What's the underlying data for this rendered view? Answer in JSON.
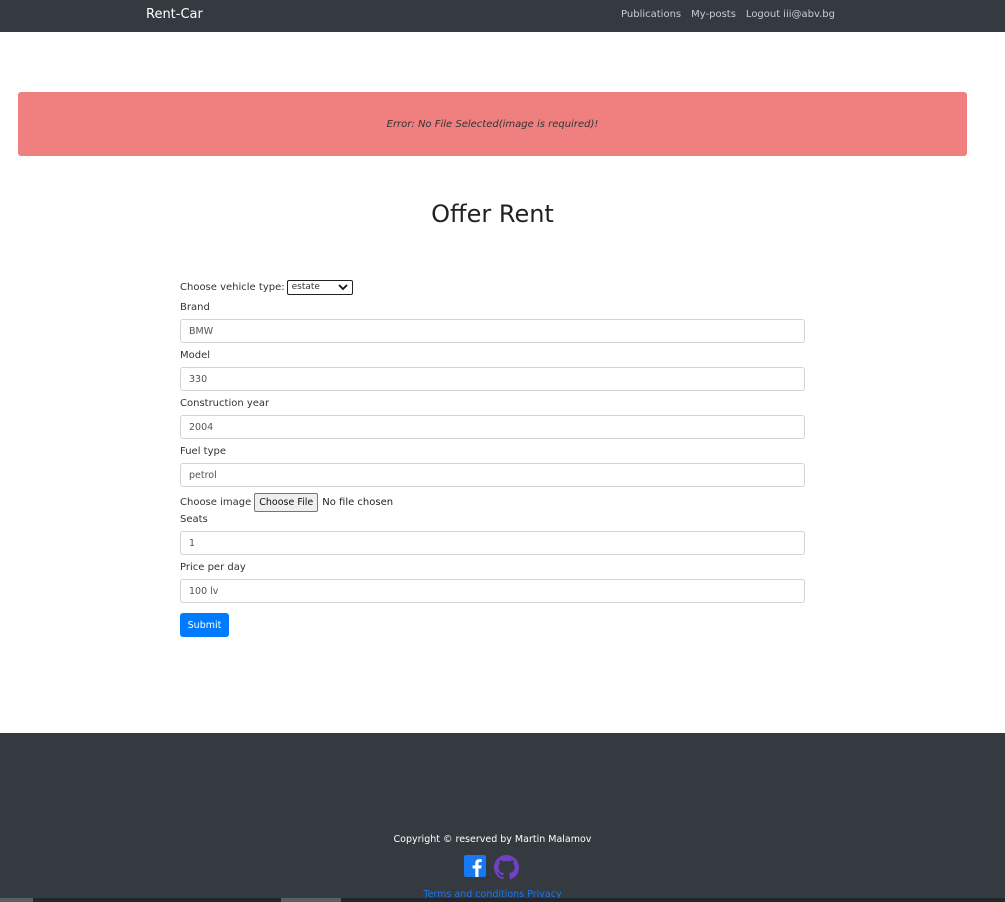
{
  "navbar": {
    "brand": "Rent-Car",
    "links": [
      "Publications",
      "My-posts"
    ],
    "logout_label": "Logout",
    "user_email": "iii@abv.bg"
  },
  "alert": {
    "message": "Error: No File Selected(image is required)!",
    "color": "#f08080"
  },
  "page": {
    "title": "Offer Rent"
  },
  "form": {
    "vehicle_type_label": "Choose vehicle type:",
    "vehicle_type_value": "estate",
    "brand_label": "Brand",
    "brand_value": "BMW",
    "model_label": "Model",
    "model_value": "330",
    "year_label": "Construction year",
    "year_value": "2004",
    "fuel_label": "Fuel type",
    "fuel_value": "petrol",
    "image_label": "Choose image",
    "file_button": "Choose File",
    "file_status": "No file chosen",
    "seats_label": "Seats",
    "seats_value": "1",
    "price_label": "Price per day",
    "price_value": "100 lv",
    "submit_label": "Submit",
    "submit_color": "#007bff"
  },
  "footer": {
    "copyright": "Copyright © reserved by Martin Malamov",
    "terms_label": "Terms and conditions",
    "privacy_label": "Privacy",
    "icons": [
      "facebook-icon",
      "github-icon"
    ]
  }
}
